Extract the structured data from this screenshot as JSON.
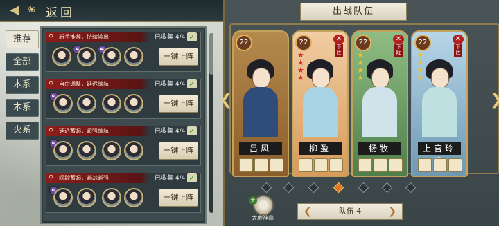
{
  "header": {
    "back_label": "返回"
  },
  "filters": [
    "推荐",
    "全部",
    "木系",
    "木系",
    "火系"
  ],
  "cards": [
    {
      "title": "新手推荐，持续输出",
      "collected": "已收集 4/4",
      "button": "一键上阵"
    },
    {
      "title": "自由调整，延迟续航",
      "collected": "已收集 4/4",
      "button": "一键上阵"
    },
    {
      "title": "延迟蓄起，超强续航",
      "collected": "已收集 4/4",
      "button": "一键上阵"
    },
    {
      "title": "间歇蓄起，越战越强",
      "collected": "已收集 4/4",
      "button": "一键上阵"
    }
  ],
  "team_panel": {
    "title": "出战队伍",
    "slots": [
      {
        "name": "吕风",
        "level": "22",
        "stars": 0,
        "removable": false
      },
      {
        "name": "柳盈",
        "level": "22",
        "stars": 4,
        "removable": true,
        "remove_label": "下阵"
      },
      {
        "name": "杨牧",
        "level": "22",
        "stars": 4,
        "removable": true,
        "remove_label": "下阵"
      },
      {
        "name": "上官玲珑",
        "level": "22",
        "stars": 4,
        "removable": true,
        "remove_label": "下阵"
      }
    ],
    "page_count": 7,
    "active_page": 4,
    "team_label": "队伍 4",
    "artifact_label": "太虚神鼎"
  },
  "colors": {
    "accent": "#c2a25c",
    "active_dot": "#e07a22",
    "remove": "#b11f1f"
  }
}
